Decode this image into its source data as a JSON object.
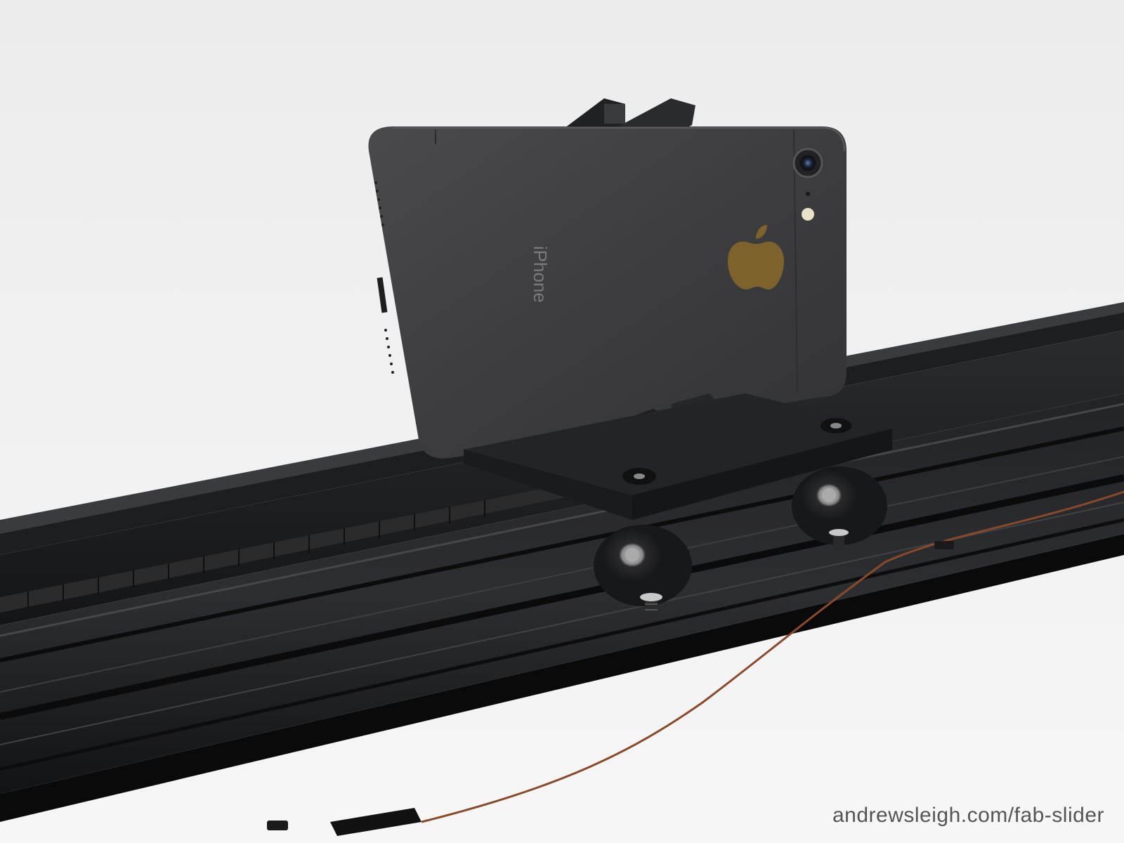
{
  "photo": {
    "subject": "Phone mounted on a motorized camera slider rail"
  },
  "phone_back": {
    "brand_text": "iPhone"
  },
  "watermark": {
    "text": "andrewsleigh.com/fab-slider"
  },
  "colors": {
    "background": "#f1f1f1",
    "rail": "#1b1c1e",
    "phone": "#3a3a3c",
    "wire": "#8a4a2a"
  }
}
